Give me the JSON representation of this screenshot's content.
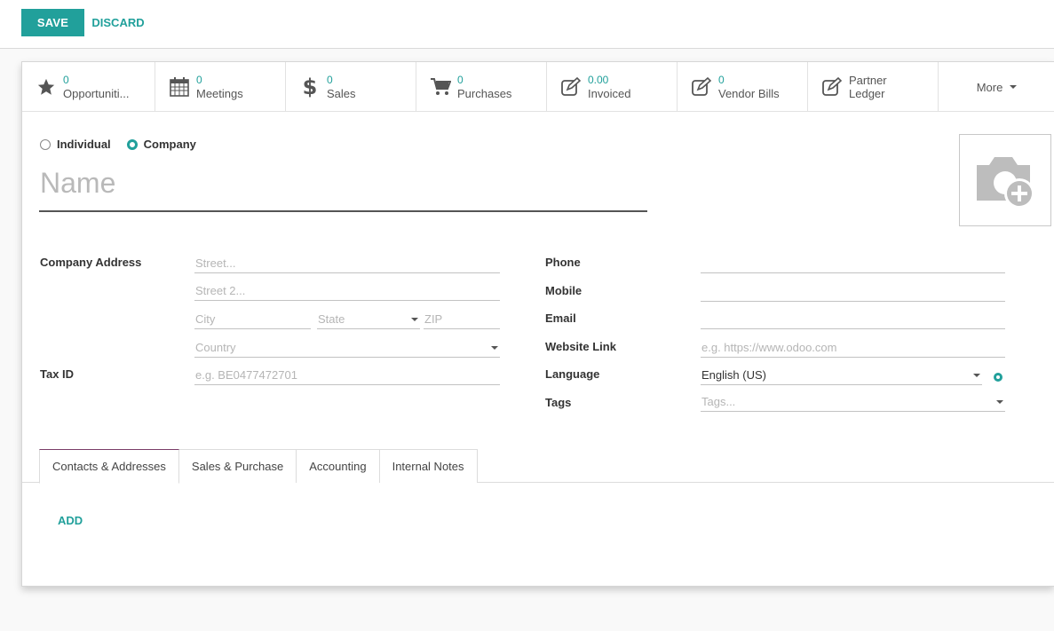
{
  "control_panel": {
    "save_label": "SAVE",
    "discard_label": "DISCARD"
  },
  "stat_buttons": [
    {
      "value": "0",
      "label": "Opportuniti...",
      "icon": "star-icon"
    },
    {
      "value": "0",
      "label": "Meetings",
      "icon": "calendar-icon"
    },
    {
      "value": "0",
      "label": "Sales",
      "icon": "dollar-icon"
    },
    {
      "value": "0",
      "label": "Purchases",
      "icon": "cart-icon"
    },
    {
      "value": "0.00",
      "label": "Invoiced",
      "icon": "edit-icon"
    },
    {
      "value": "0",
      "label": "Vendor Bills",
      "icon": "edit-icon"
    },
    {
      "value": "Partner",
      "label": "Ledger",
      "icon": "edit-icon"
    }
  ],
  "more_label": "More",
  "company_type": {
    "individual": "Individual",
    "company": "Company",
    "selected": "Company"
  },
  "name_placeholder": "Name",
  "labels": {
    "company_address": "Company Address",
    "tax_id": "Tax ID",
    "phone": "Phone",
    "mobile": "Mobile",
    "email": "Email",
    "website": "Website Link",
    "language": "Language",
    "tags": "Tags"
  },
  "placeholders": {
    "street": "Street...",
    "street2": "Street 2...",
    "city": "City",
    "state": "State",
    "zip": "ZIP",
    "country": "Country",
    "tax_id": "e.g. BE0477472701",
    "website": "e.g. https://www.odoo.com",
    "tags": "Tags..."
  },
  "values": {
    "language": "English (US)"
  },
  "tabs": [
    "Contacts & Addresses",
    "Sales & Purchase",
    "Accounting",
    "Internal Notes"
  ],
  "active_tab": "Contacts & Addresses",
  "add_label": "ADD",
  "colors": {
    "accent": "#21a09b",
    "tab_active_border": "#7a3c68"
  }
}
